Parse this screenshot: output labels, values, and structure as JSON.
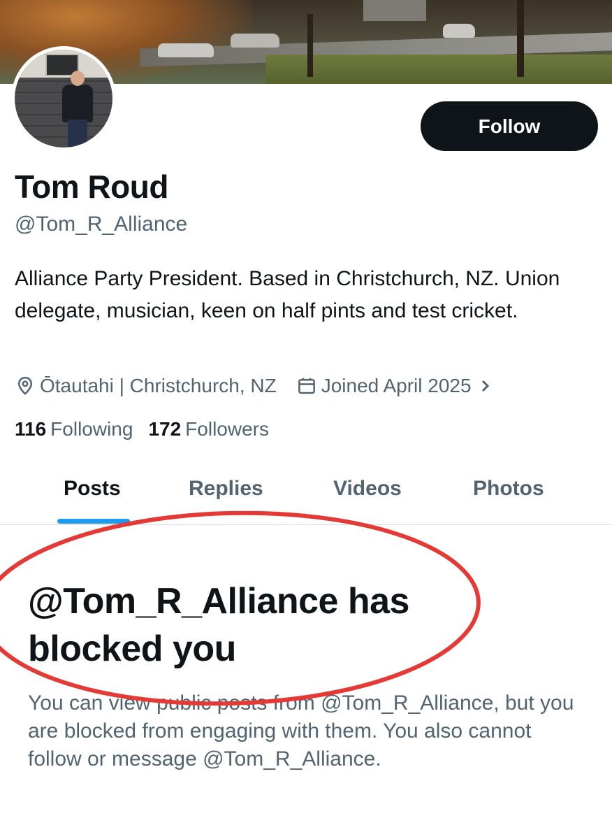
{
  "profile": {
    "name": "Tom Roud",
    "handle": "@Tom_R_Alliance",
    "bio": "Alliance Party President. Based in Christchurch, NZ. Union delegate, musician, keen on half pints and test cricket.",
    "location": "Ōtautahi | Christchurch, NZ",
    "joined": "Joined April 2025",
    "following_count": "116",
    "following_label": "Following",
    "followers_count": "172",
    "followers_label": "Followers",
    "follow_button": "Follow"
  },
  "tabs": [
    {
      "label": "Posts",
      "active": true
    },
    {
      "label": "Replies",
      "active": false
    },
    {
      "label": "Videos",
      "active": false
    },
    {
      "label": "Photos",
      "active": false
    }
  ],
  "blocked": {
    "title": "@Tom_R_Alliance has blocked you",
    "message": "You can view public posts from @Tom_R_Alliance, but you are blocked from engaging with them. You also cannot follow or message @Tom_R_Alliance."
  },
  "icons": {
    "location": "location-pin-icon",
    "calendar": "calendar-icon",
    "chevron": "chevron-right-icon"
  },
  "colors": {
    "accent": "#1d9bf0",
    "button_bg": "#0f1419",
    "secondary_text": "#536471",
    "annotation_red": "#e53935"
  }
}
